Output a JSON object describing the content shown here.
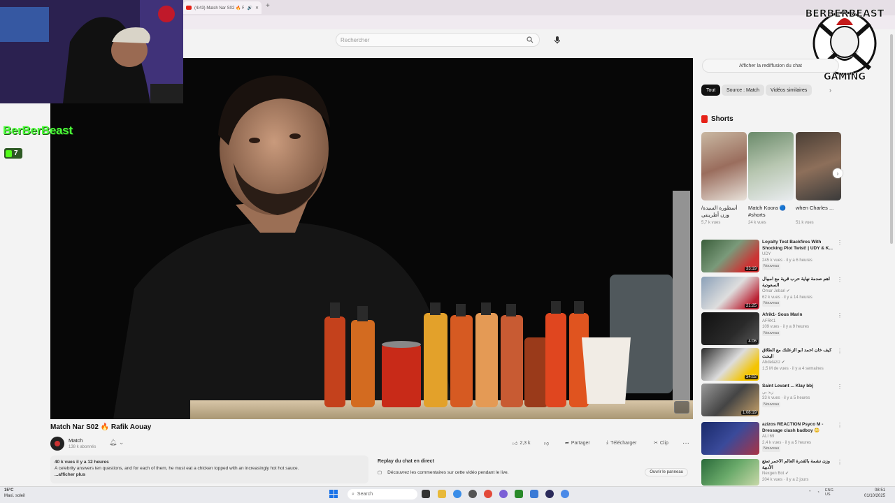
{
  "browser": {
    "tab_title": "(4/43) Match Nar S02 🔥 Ra...",
    "new_tab": "+"
  },
  "header": {
    "search_placeholder": "Rechercher"
  },
  "overlay": {
    "kick_name": "BerBerBeast",
    "kick_viewers": "7"
  },
  "video": {
    "title": "Match Nar S02 🔥 Rafik Aouay",
    "channel": "Match",
    "subscribers": "138 k abonnés",
    "likes": "2,3 k",
    "share": "Partager",
    "download": "Télécharger",
    "clip": "Clip",
    "more": "···"
  },
  "description": {
    "stats": "40 k vues  il y a 12 heures",
    "text": "A celebrity answers ten questions, and for each of them, he must eat a chicken topped with an increasingly hot hot sauce.",
    "more": "...afficher plus"
  },
  "chat": {
    "title": "Replay du chat en direct",
    "text": "Découvrez les commentaires sur cette vidéo pendant le live.",
    "open": "Ouvrir le panneau",
    "replay_button": "Afficher la rediffusion du chat"
  },
  "chips": [
    "Tout",
    "Source : Match",
    "Vidéos similaires"
  ],
  "shorts": {
    "heading": "Shorts",
    "items": [
      {
        "title": "أسطورة السيدة/ وزن أطرينتي",
        "views": "5,7 k vues"
      },
      {
        "title": "Match Koora 🔵 #shorts",
        "views": "24 k vues"
      },
      {
        "title": "when Charles ...",
        "views": "51 k vues"
      }
    ]
  },
  "recommendations": [
    {
      "title": "Loyalty Test Backfires With Shocking Plot Twist! | UDY & K...",
      "channel": "UDY",
      "meta": "245 k vues · il y a 6 heures",
      "badge": "Nouveau",
      "duration": "33:19"
    },
    {
      "title": "أهم صدمة نهاية حرب قرية مع أمبيال السعودية",
      "channel": "Omar Jebari ✔",
      "meta": "62 k vues · il y a 14 heures",
      "badge": "Nouveau",
      "duration": "21:25"
    },
    {
      "title": "Afrik1- Sous Marin",
      "channel": "AFRK1",
      "meta": "109 vues · il y a 9 heures",
      "badge": "Nouveau",
      "duration": "4:06"
    },
    {
      "title": "كيف خان أحمد أبو الزعلنك مع الطلاق البحث",
      "channel": "Abdelaziz ✔",
      "meta": "1,5 M de vues · il y a 4 semaines",
      "badge": "",
      "duration": "34:02"
    },
    {
      "title": "Saint Levant ... Klay bbj",
      "channel": "زيد بي",
      "meta": "33 k vues · il y a 5 heures",
      "badge": "Nouveau",
      "duration": "1:08:19"
    },
    {
      "title": "azizos REACTION Psyco M - Dressage clash badboy 😳",
      "channel": "ALI 69",
      "meta": "2,4 k vues · il y a 5 heures",
      "badge": "Nouveau",
      "duration": ""
    },
    {
      "title": "وزن نشمة بالقدرة العالم الأحمر تمتع الأدبية",
      "channel": "Nexgen Bot ✔",
      "meta": "204 k vues · il y a 2 jours",
      "badge": "",
      "duration": ""
    }
  ],
  "taskbar": {
    "weather_temp": "15°C",
    "weather_text": "Maxi. soleil",
    "search": "Search",
    "lang": "ENG",
    "lang2": "US",
    "time": "08:51",
    "date": "01/10/2025"
  },
  "colors": {
    "youtube_red": "#e62117",
    "kick_green": "#53fc18",
    "chip_active": "#111111"
  }
}
